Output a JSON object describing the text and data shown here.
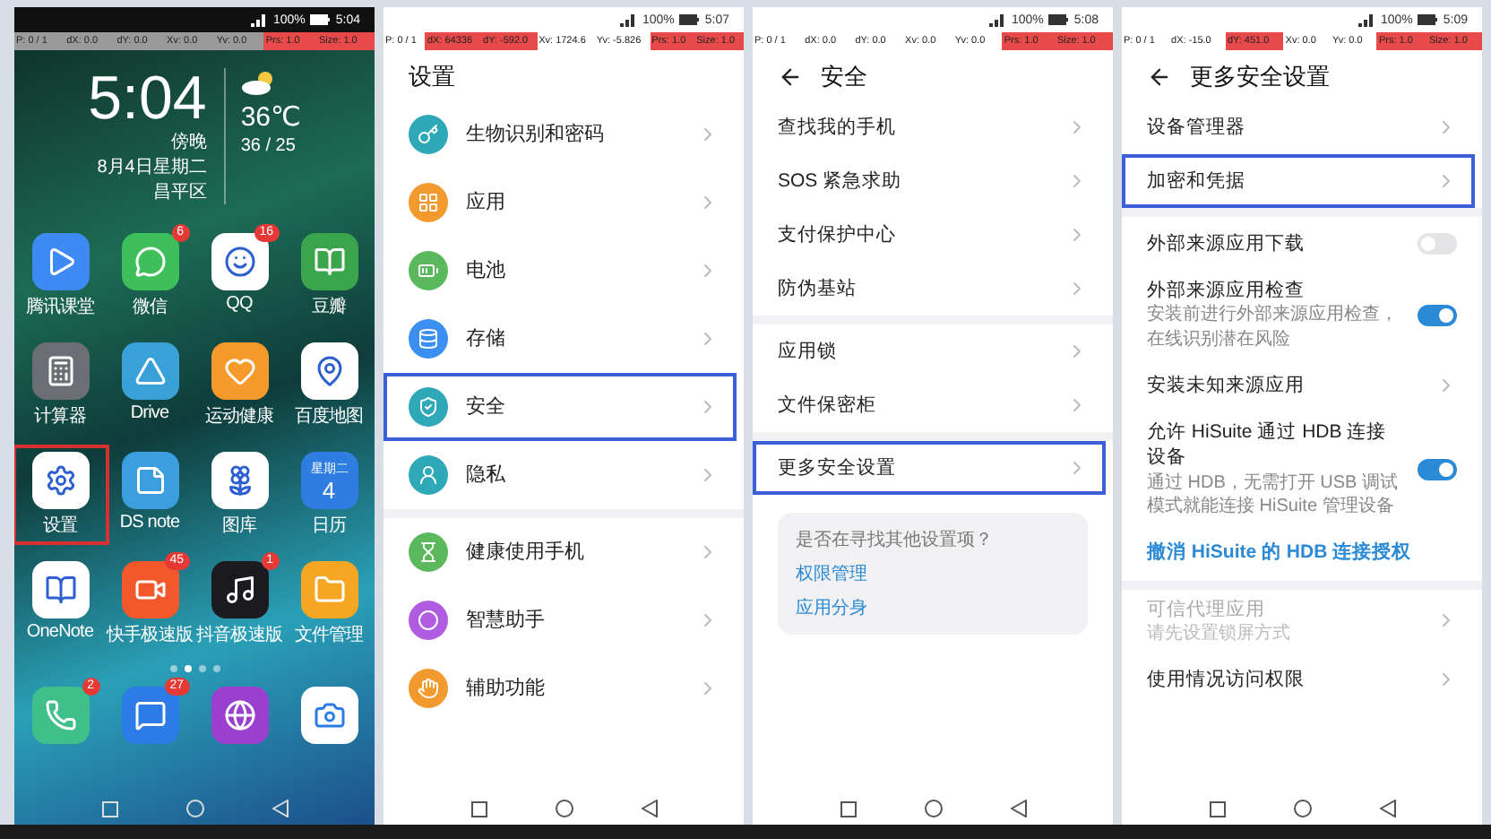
{
  "screens": [
    {
      "kind": "home",
      "status": {
        "time": "5:04",
        "battery": "100%"
      },
      "debug": [
        {
          "text": "P: 0 / 1",
          "alert": false
        },
        {
          "text": "dX: 0.0",
          "alert": false
        },
        {
          "text": "dY: 0.0",
          "alert": false
        },
        {
          "text": "Xv: 0.0",
          "alert": false
        },
        {
          "text": "Yv: 0.0",
          "alert": false
        },
        {
          "text": "Prs: 1.0",
          "alert": true
        },
        {
          "text": "Size: 1.0",
          "alert": true
        }
      ],
      "clock": {
        "time": "5:04",
        "period": "傍晚",
        "date": "8月4日星期二",
        "location": "昌平区",
        "temperature": "36℃",
        "range": "36 / 25"
      },
      "apps": [
        {
          "label": "腾讯课堂",
          "color": "#3d8bf2",
          "selected": false
        },
        {
          "label": "微信",
          "color": "#3fbf5a",
          "badge": "6",
          "selected": false
        },
        {
          "label": "QQ",
          "color": "#ffffff",
          "badge": "16",
          "selected": false
        },
        {
          "label": "豆瓣",
          "color": "#3aa54a",
          "selected": false
        },
        {
          "label": "计算器",
          "color": "#6b6e75",
          "selected": false
        },
        {
          "label": "Drive",
          "color": "#3aa0d8",
          "selected": false
        },
        {
          "label": "运动健康",
          "color": "#f59a2b",
          "selected": false
        },
        {
          "label": "百度地图",
          "color": "#ffffff",
          "selected": false
        },
        {
          "label": "设置",
          "color": "#ffffff",
          "selected": true
        },
        {
          "label": "DS note",
          "color": "#3a9fdc",
          "selected": false
        },
        {
          "label": "图库",
          "color": "#ffffff",
          "selected": false
        },
        {
          "label": "日历",
          "color": "#2f7de1",
          "icon_lines": [
            "星期二",
            "4"
          ],
          "selected": false
        },
        {
          "label": "OneNote",
          "color": "#ffffff",
          "selected": false
        },
        {
          "label": "快手极速版",
          "color": "#f2582c",
          "badge": "45",
          "selected": false
        },
        {
          "label": "抖音极速版",
          "color": "#1b1b1f",
          "badge": "1",
          "selected": false
        },
        {
          "label": "文件管理",
          "color": "#f5a623",
          "selected": false
        }
      ],
      "dock": [
        {
          "color": "#3fbf8a",
          "badge": "2"
        },
        {
          "color": "#2d7be6",
          "badge": "27"
        },
        {
          "color": "#9b3fd1"
        },
        {
          "color": "#ffffff"
        }
      ]
    },
    {
      "kind": "list",
      "status": {
        "time": "5:07",
        "battery": "100%"
      },
      "debug": [
        {
          "text": "P: 0 / 1",
          "alert": false
        },
        {
          "text": "dX: 64336",
          "alert": true
        },
        {
          "text": "dY: -592.0",
          "alert": true
        },
        {
          "text": "Xv: 1724.6",
          "alert": false
        },
        {
          "text": "Yv: -5.826",
          "alert": false
        },
        {
          "text": "Prs: 1.0",
          "alert": true
        },
        {
          "text": "Size: 1.0",
          "alert": true
        }
      ],
      "title": "设置",
      "back": false,
      "groups": [
        [
          {
            "kind": "nav",
            "label": "生物识别和密码",
            "color": "#2fa9b8",
            "selected": false
          },
          {
            "kind": "nav",
            "label": "应用",
            "color": "#f29a2e",
            "selected": false
          },
          {
            "kind": "nav",
            "label": "电池",
            "color": "#5cb85c",
            "selected": false
          },
          {
            "kind": "nav",
            "label": "存储",
            "color": "#3b8ff0",
            "selected": false
          },
          {
            "kind": "nav",
            "label": "安全",
            "color": "#2fa9b8",
            "selected": true
          },
          {
            "kind": "nav",
            "label": "隐私",
            "color": "#2fa9b8",
            "selected": false
          }
        ],
        [
          {
            "kind": "nav",
            "label": "健康使用手机",
            "color": "#5cb85c",
            "selected": false
          },
          {
            "kind": "nav",
            "label": "智慧助手",
            "color": "#b05ce0",
            "selected": false
          },
          {
            "kind": "nav",
            "label": "辅助功能",
            "color": "#f29a2e",
            "selected": false
          }
        ]
      ]
    },
    {
      "kind": "list",
      "status": {
        "time": "5:08",
        "battery": "100%"
      },
      "debug": [
        {
          "text": "P: 0 / 1",
          "alert": false
        },
        {
          "text": "dX: 0.0",
          "alert": false
        },
        {
          "text": "dY: 0.0",
          "alert": false
        },
        {
          "text": "Xv: 0.0",
          "alert": false
        },
        {
          "text": "Yv: 0.0",
          "alert": false
        },
        {
          "text": "Prs: 1.0",
          "alert": true
        },
        {
          "text": "Size: 1.0",
          "alert": true
        }
      ],
      "title": "安全",
      "back": true,
      "groups": [
        [
          {
            "kind": "nav",
            "label": "查找我的手机",
            "selected": false
          },
          {
            "kind": "nav",
            "label": "SOS 紧急求助",
            "selected": false
          },
          {
            "kind": "nav",
            "label": "支付保护中心",
            "selected": false
          },
          {
            "kind": "nav",
            "label": "防伪基站",
            "selected": false
          }
        ],
        [
          {
            "kind": "nav",
            "label": "应用锁",
            "selected": false
          },
          {
            "kind": "nav",
            "label": "文件保密柜",
            "selected": false
          }
        ],
        [
          {
            "kind": "nav",
            "label": "更多安全设置",
            "selected": true
          }
        ]
      ],
      "hint": {
        "question": "是否在寻找其他设置项？",
        "links": [
          "权限管理",
          "应用分身"
        ]
      }
    },
    {
      "kind": "list",
      "status": {
        "time": "5:09",
        "battery": "100%"
      },
      "debug": [
        {
          "text": "P: 0 / 1",
          "alert": false
        },
        {
          "text": "dX: -15.0",
          "alert": false
        },
        {
          "text": "dY: 451.0",
          "alert": true
        },
        {
          "text": "Xv: 0.0",
          "alert": false
        },
        {
          "text": "Yv: 0.0",
          "alert": false
        },
        {
          "text": "Prs: 1.0",
          "alert": true
        },
        {
          "text": "Size: 1.0",
          "alert": true
        }
      ],
      "title": "更多安全设置",
      "back": true,
      "groups": [
        [
          {
            "kind": "nav",
            "label": "设备管理器",
            "selected": false
          },
          {
            "kind": "nav",
            "label": "加密和凭据",
            "selected": true
          }
        ],
        [
          {
            "kind": "toggle",
            "label": "外部来源应用下载",
            "on": false
          },
          {
            "kind": "toggle",
            "label": "外部来源应用检查",
            "subtitle": "安装前进行外部来源应用检查，在线识别潜在风险",
            "on": true
          },
          {
            "kind": "nav",
            "label": "安装未知来源应用",
            "selected": false
          },
          {
            "kind": "toggle",
            "label": "允许 HiSuite 通过 HDB 连接设备",
            "subtitle": "通过 HDB，无需打开 USB 调试模式就能连接 HiSuite 管理设备",
            "on": true
          },
          {
            "kind": "link",
            "label": "撤消 HiSuite 的 HDB 连接授权"
          }
        ],
        [
          {
            "kind": "nav",
            "label": "可信代理应用",
            "subtitle": "请先设置锁屏方式",
            "disabled": true,
            "selected": false
          },
          {
            "kind": "nav",
            "label": "使用情况访问权限",
            "selected": false
          }
        ]
      ]
    }
  ]
}
